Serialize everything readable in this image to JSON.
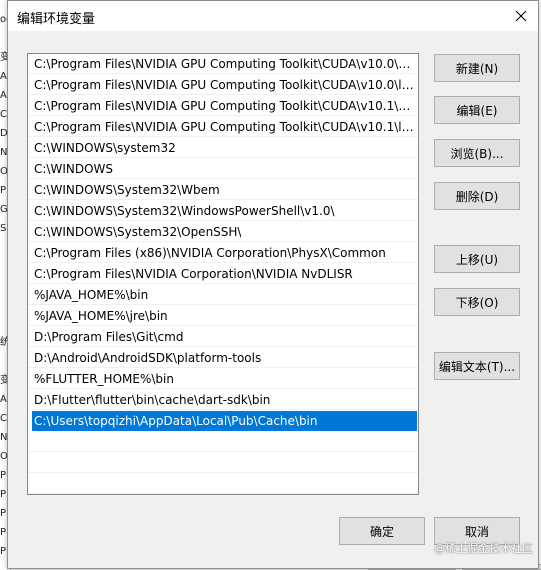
{
  "dialog": {
    "title": "编辑环境变量"
  },
  "background": {
    "edge_chars": [
      "oo",
      "",
      "变",
      "A",
      "A",
      "C",
      "D",
      "N",
      "O",
      "P",
      "G",
      "S",
      "",
      "",
      "",
      "",
      "",
      "统",
      "",
      "变",
      "A",
      "C",
      "N",
      "O",
      "P",
      "P",
      "P",
      "P",
      "P"
    ]
  },
  "paths": [
    "C:\\Program Files\\NVIDIA GPU Computing Toolkit\\CUDA\\v10.0\\bin",
    "C:\\Program Files\\NVIDIA GPU Computing Toolkit\\CUDA\\v10.0\\libnvvp",
    "C:\\Program Files\\NVIDIA GPU Computing Toolkit\\CUDA\\v10.1\\bin",
    "C:\\Program Files\\NVIDIA GPU Computing Toolkit\\CUDA\\v10.1\\libnvvp",
    "C:\\WINDOWS\\system32",
    "C:\\WINDOWS",
    "C:\\WINDOWS\\System32\\Wbem",
    "C:\\WINDOWS\\System32\\WindowsPowerShell\\v1.0\\",
    "C:\\WINDOWS\\System32\\OpenSSH\\",
    "C:\\Program Files (x86)\\NVIDIA Corporation\\PhysX\\Common",
    "C:\\Program Files\\NVIDIA Corporation\\NVIDIA NvDLISR",
    "%JAVA_HOME%\\bin",
    "%JAVA_HOME%\\jre\\bin",
    "D:\\Program Files\\Git\\cmd",
    "D:\\Android\\AndroidSDK\\platform-tools",
    "%FLUTTER_HOME%\\bin",
    "D:\\Flutter\\flutter\\bin\\cache\\dart-sdk\\bin",
    "C:\\Users\\topqizhi\\AppData\\Local\\Pub\\Cache\\bin"
  ],
  "selected_index": 17,
  "buttons": {
    "new": "新建(N)",
    "edit": "编辑(E)",
    "browse": "浏览(B)...",
    "delete": "删除(D)",
    "move_up": "上移(U)",
    "move_down": "下移(O)",
    "edit_text": "编辑文本(T)...",
    "ok": "确定",
    "cancel": "取消"
  },
  "watermark": "@稀土掘金技术社区",
  "colors": {
    "selection": "#0078d7",
    "button_face": "#e1e1e1",
    "button_border": "#adadad",
    "list_border": "#828790"
  }
}
